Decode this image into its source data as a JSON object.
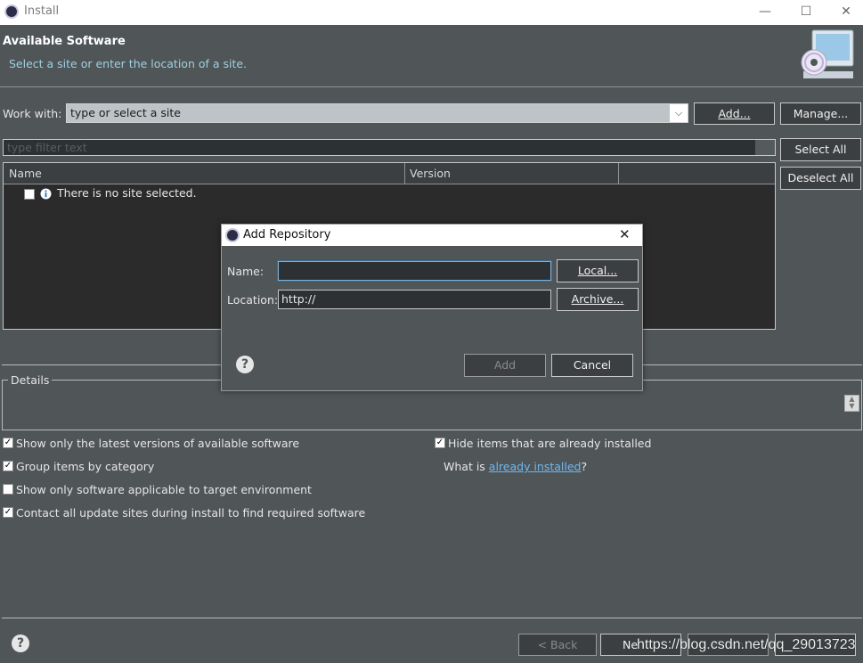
{
  "window": {
    "title": "Install",
    "minimize_glyph": "—",
    "maximize_glyph": "☐",
    "close_glyph": "✕"
  },
  "header": {
    "title": "Available Software",
    "subtitle": "Select a site or enter the location of a site."
  },
  "work_with": {
    "label": "Work with:",
    "value": "type or select a site",
    "add_button": "Add...",
    "manage_button": "Manage..."
  },
  "filter": {
    "placeholder": "type filter text"
  },
  "side_buttons": {
    "select_all": "Select All",
    "deselect_all": "Deselect All"
  },
  "table": {
    "columns": [
      "Name",
      "Version",
      ""
    ],
    "message": "There is no site selected."
  },
  "dialog": {
    "title": "Add Repository",
    "name_label": "Name:",
    "name_value": "",
    "location_label": "Location:",
    "location_value": "http://",
    "local_button": "Local...",
    "archive_button": "Archive...",
    "add_button": "Add",
    "cancel_button": "Cancel"
  },
  "details": {
    "legend": "Details"
  },
  "options": [
    {
      "label": "Show only the latest versions of available software",
      "checked": true
    },
    {
      "label": "Group items by category",
      "checked": true
    },
    {
      "label": "Show only software applicable to target environment",
      "checked": false
    },
    {
      "label": "Contact all update sites during install to find required software",
      "checked": true
    }
  ],
  "hide_installed": {
    "label": "Hide items that are already installed",
    "checked": true
  },
  "what_is": {
    "prefix": "What is ",
    "link": "already installed",
    "suffix": "?"
  },
  "footer": {
    "back_button": "< Back",
    "next_button": "Ne",
    "finish_button": "Finish",
    "cancel_button": ""
  },
  "watermark": "https://blog.csdn.net/qq_29013723",
  "colors": {
    "background": "#505558",
    "link": "#6fb8ef",
    "subtitle": "#9fd0e0"
  }
}
